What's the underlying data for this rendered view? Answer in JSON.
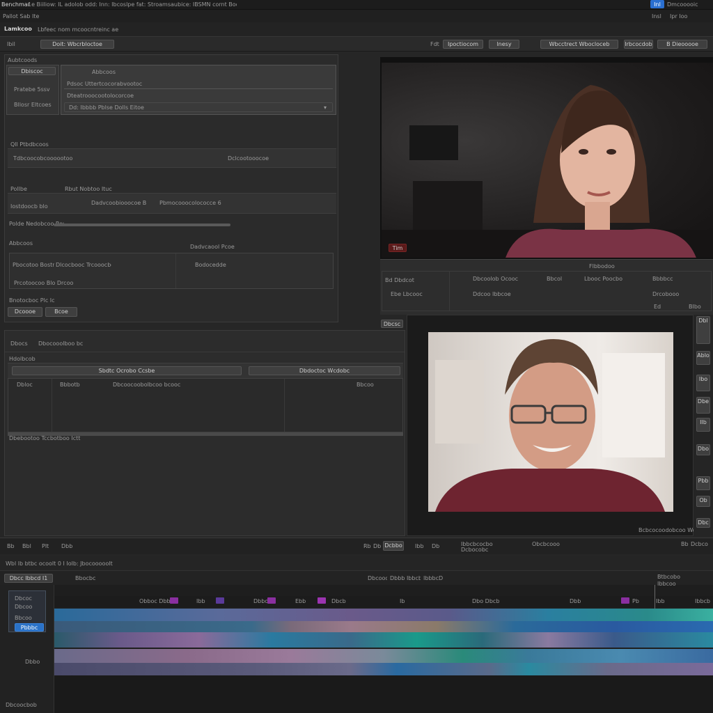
{
  "app": {
    "menu_left": "Benchmark",
    "menu_text": "1e Biiliow: IL adolob odd: Inn: Ibcoslpe fat: Stroamsaubice: IBSMN cornt Boore",
    "menu_right_btn": "Inl",
    "menu_right_text": "Dmcooooic",
    "sub_menu": "Pallot Sab Ite",
    "project_title": "Lamkcoo",
    "project_sub": "Lbfeec nom mcoocntreinc ae",
    "menu_small": "Insl",
    "menu_small2": "Ipr Ioo"
  },
  "toolbar": {
    "left_label": "Ibil",
    "left_btn": "Doit: Wbcrbloctoe",
    "right_items": [
      "Fdt",
      "Ipoctiocom",
      "lnesy",
      "Wbcctrect Wbocloceb",
      "Irbcocdob",
      "B Dieooooe"
    ]
  },
  "left_panel": {
    "header": "Aubtcoods",
    "side_tabs": [
      "Dbiscoc",
      "Pratebe 5ssv",
      "Bllosr Eltcoes"
    ],
    "box_title": "Abbcoos",
    "box_line1": "Pdsoc Uttertcocorabvootoc",
    "box_line2": "Dteatrooocootolocorcoe",
    "box_select": "Dd: Ibbbb Pblse Dolls Eitoe",
    "section1": "Qll Ptbdbcoos",
    "row1_left": "Tdbcoocobcoooootoo",
    "row1_right": "Dclcootooocoe",
    "section2_a": "Pollbe",
    "section2_b": "Rbut Nobtoo Ituc",
    "row2_left": "Iostdoocb blo",
    "row2_mid": "Dadvcoobiooocoe B",
    "row2_right": "Pbmocooocolococce 6",
    "slider_label": "Polde Nedobcoo Roue",
    "section3": "Abbcoos",
    "section3_mid": "Dadvcaool Pcoe",
    "table_a": "Pbocotoo Bostr",
    "table_b": "Dlcocbooc Trcooocbo",
    "table_c": "Bodocedde",
    "table_d": "Prcotoocoo Blo Drcoo",
    "foot_label": "Dcoooe",
    "foot_btn": "Bcoe",
    "foot_small": "Bnotocboc Plc Ic"
  },
  "mid_panel": {
    "tab": "Dbocs",
    "tab2": "Dbocooolboo bc",
    "section": "Hdolbcob",
    "row_btn1": "Sbdtc Ocrobo Ccsbe",
    "row_btn2": "Dbdoctoc Wcdobc",
    "col1": "Dbloc",
    "col2": "Bbbotb",
    "col3": "Dbcoocoobolbcoo bcooc",
    "col4": "Bbcoo",
    "footer": "Dbebootoo Tccbotboo Ictt"
  },
  "viewer_top": {
    "badge": "Tim",
    "info_title": "Flbbodoo",
    "row_a": "Bd Dbdcot",
    "row_b": "Dbcoolob Ocooc",
    "row_c": "Bbcol",
    "row_d": "Lbooc Poocbo",
    "row_e": "Bbbbcc",
    "row_f": "Ebe Lbcooc",
    "row_g": "Ddcoo Ibbcoe",
    "row_h": "Drcobooo",
    "row_i": "Ed",
    "row_j": "BIbo"
  },
  "viewer_bottom": {
    "label": "Dbcsc",
    "caption": "Bcbcocoodobcoo Wobb",
    "side_icons": [
      "Dbl",
      "Ablo",
      "Ibo",
      "Dbe",
      "Ilb",
      "Dbo",
      "Pbb",
      "Ob",
      "Dbc"
    ]
  },
  "transport": {
    "left_items": [
      "Bb",
      "Bbl",
      "Plt",
      "Dbb"
    ],
    "mid_items": [
      "Rb",
      "Db",
      "Dcbbo"
    ],
    "right_items": [
      "Ibb",
      "Db",
      "Ibbcbcocbobc",
      "Dcbocobc",
      "Obcbcooo",
      "Bb",
      "Dcbco"
    ]
  },
  "timeline": {
    "header": "Wbl lb btbc  ocoolt  0  I  Iolb:  Jbocooooolt",
    "track_header": "Dbcc  Ibbcd  I1",
    "sub_header": "Bbocbc",
    "ruler_items": [
      "Dbcoocoo Ibo",
      "Dbbb Ibbcbc",
      "IbbbcD"
    ],
    "ruler_right": [
      "Btbcobo",
      "Ibbcoo"
    ],
    "labels_row": [
      "Obboc Dbbc",
      "Ibb",
      "Dbbo",
      "Ebb",
      "Dbcb",
      "Ib",
      "Dbo Dbcb",
      "Dbb",
      "Pb",
      "Ibb",
      "Ibbcb"
    ],
    "track_name_top": "Dbcoc",
    "track_name_mid": "Dbcoo",
    "track_name_mid2": "Bbcoo",
    "track_selected": "Pbbbc",
    "track_name_bottom": "Dbbo",
    "footer": "Dbcoocbob"
  },
  "colors": {
    "accent": "#3a7bd5",
    "magenta": "#b040c0",
    "teal": "#2aa198",
    "blue": "#3a6fd0"
  }
}
